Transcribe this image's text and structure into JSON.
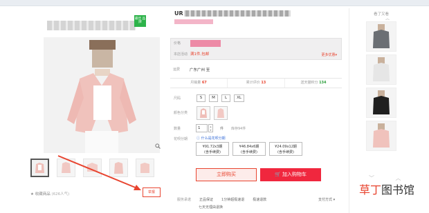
{
  "colors": {
    "accent": "#e8442f",
    "cart_button": "#f0273e",
    "badge_green": "#2db34a",
    "link_blue": "#3a6fd8"
  },
  "shop": {
    "badge": "最佳\n品牌",
    "logo_tail": "VO"
  },
  "gallery": {
    "thumbnails": 5,
    "favorite_label": "收藏商品",
    "favorite_count": "(626人气)",
    "report_link": "举报"
  },
  "product": {
    "title_prefix": "UR",
    "price_label": "价格",
    "promo_label": "本店活动",
    "promo_text": "满1件,包邮",
    "more_promo": "更多优惠▾",
    "shipping_label": "运费",
    "shipping_value": "广东广州 至",
    "stats": [
      {
        "label": "月销量",
        "value": "67",
        "color": "#e8442f"
      },
      {
        "label": "累计评价",
        "value": "13",
        "color": "#e8442f"
      },
      {
        "label": "送天猫积分",
        "value": "134",
        "color": "#2a9d3a"
      }
    ],
    "size_label": "尺码",
    "sizes": [
      "S",
      "M",
      "L",
      "XL"
    ],
    "color_label": "颜色分类",
    "quantity_label": "数量",
    "quantity_value": "1",
    "quantity_unit": "件",
    "stock_text": "库存94件",
    "installment_label": "花呗分期",
    "installment_help": "什么是花呗分期",
    "installments": [
      {
        "line1": "¥91.72x3期",
        "line2": "(含手续费)"
      },
      {
        "line1": "¥46.84x6期",
        "line2": "(含手续费)"
      },
      {
        "line1": "¥24.09x12期",
        "line2": "(含手续费)"
      }
    ],
    "buy_now": "立即购买",
    "add_to_cart": "加入购物车",
    "service_label": "服务承诺",
    "promises": [
      "正品保证",
      "1分钟超极速退",
      "极速退款"
    ],
    "promise_line2": "七天无理由退换",
    "pay_method": "支付方式 ▾"
  },
  "sidebar": {
    "title": "看了又看",
    "up_arrow": "︿",
    "nav": "﹀ ︿"
  },
  "watermark": {
    "accent": "草丁",
    "rest": "图书馆"
  }
}
